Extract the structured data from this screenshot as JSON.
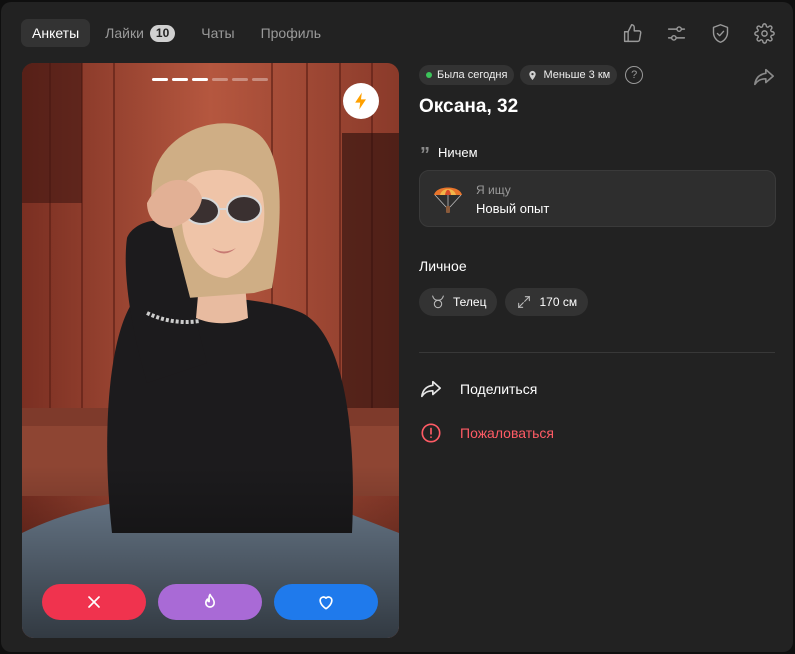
{
  "nav": {
    "tabs": [
      {
        "label": "Анкеты",
        "active": true
      },
      {
        "label": "Лайки",
        "badge": "10"
      },
      {
        "label": "Чаты"
      },
      {
        "label": "Профиль"
      }
    ],
    "icons": [
      "thumbs-up-icon",
      "sliders-icon",
      "shield-check-icon",
      "gear-icon"
    ]
  },
  "card": {
    "photo_index": 3,
    "photo_count": 6,
    "boost_icon": "lightning-icon",
    "buttons": {
      "dislike": "x-icon",
      "superlike": "fire-icon",
      "like": "heart-icon"
    }
  },
  "profile": {
    "status": "Была сегодня",
    "distance": "Меньше 3 км",
    "help": "?",
    "name": "Оксана, 32",
    "quote_mark": "”",
    "about": "Ничем",
    "seeking": {
      "label": "Я ищу",
      "value": "Новый опыт"
    },
    "personal_title": "Личное",
    "personal": [
      {
        "icon": "taurus-icon",
        "label": "Телец"
      },
      {
        "icon": "height-icon",
        "label": "170 см"
      }
    ],
    "share_label": "Поделиться",
    "report_label": "Пожаловаться"
  },
  "colors": {
    "background": "#222222",
    "online": "#3cc35a",
    "dislike": "#f0334e",
    "superlike": "#a96ad6",
    "like": "#1f7aec",
    "report": "#ff5b65",
    "boost": "#ffa000"
  }
}
